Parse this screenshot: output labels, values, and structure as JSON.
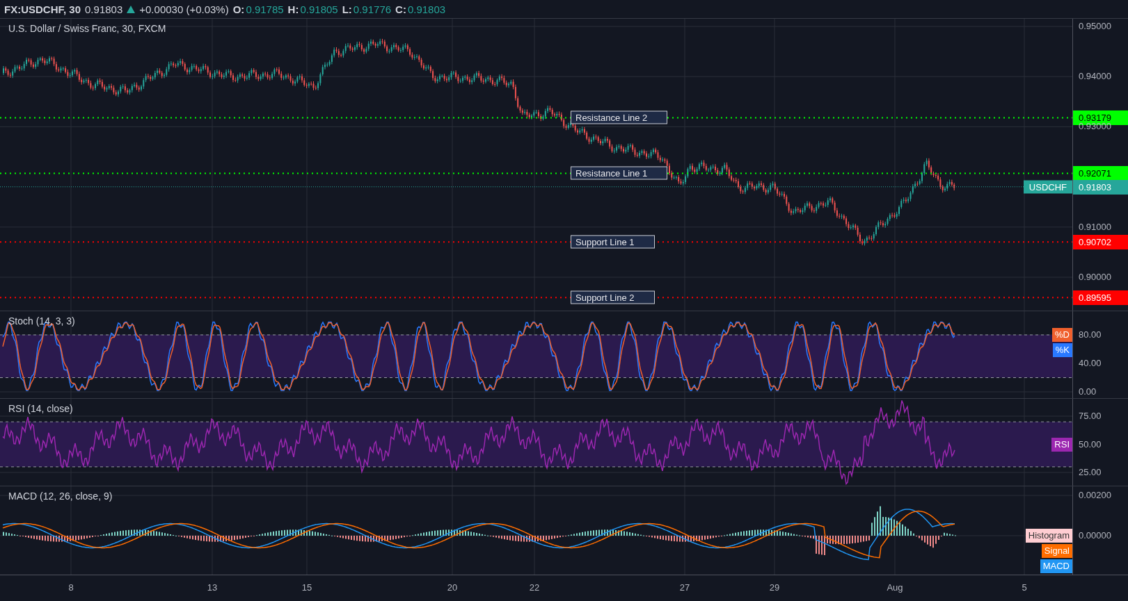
{
  "header": {
    "symbol": "FX:USDCHF, 30",
    "last": "0.91803",
    "change": "+0.00030 (+0.03%)",
    "ohlc": [
      {
        "label": "O:",
        "value": "0.91785"
      },
      {
        "label": "H:",
        "value": "0.91805"
      },
      {
        "label": "L:",
        "value": "0.91776"
      },
      {
        "label": "C:",
        "value": "0.91803"
      }
    ]
  },
  "price_pane": {
    "title": "U.S. Dollar / Swiss Franc, 30, FXCM",
    "axis_labels": [
      "0.95000",
      "0.94000",
      "0.93000",
      "0.91000",
      "0.90000"
    ],
    "levels": [
      {
        "kind": "resistance",
        "label": "Resistance Line 2",
        "price": "0.93179"
      },
      {
        "kind": "resistance",
        "label": "Resistance Line 1",
        "price": "0.92071"
      },
      {
        "kind": "support",
        "label": "Support Line 1",
        "price": "0.90702"
      },
      {
        "kind": "support",
        "label": "Support Line 2",
        "price": "0.89595"
      }
    ],
    "last_price": {
      "symbol": "USDCHF",
      "price": "0.91803"
    }
  },
  "indicators": [
    {
      "kind": "stoch",
      "title": "Stoch (14, 3, 3)",
      "axis_labels": [
        "80.00",
        "40.00",
        "0.00"
      ],
      "legend": [
        {
          "label": "%D",
          "color": "#f0602d"
        },
        {
          "label": "%K",
          "color": "#2979ff"
        }
      ]
    },
    {
      "kind": "rsi",
      "title": "RSI (14, close)",
      "axis_labels": [
        "75.00",
        "50.00",
        "25.00"
      ],
      "legend": [
        {
          "label": "RSI",
          "color": "#9c27b0"
        }
      ]
    },
    {
      "kind": "macd",
      "title": "MACD (12, 26, close, 9)",
      "axis_labels": [
        "0.00200",
        "0.00000"
      ],
      "legend": [
        {
          "label": "Histogram",
          "color": "#ffcdd2"
        },
        {
          "label": "Signal",
          "color": "#ff6d00"
        },
        {
          "label": "MACD",
          "color": "#2196f3"
        }
      ]
    }
  ],
  "time_axis": [
    "8",
    "13",
    "15",
    "20",
    "22",
    "27",
    "29",
    "Aug",
    "5"
  ]
}
